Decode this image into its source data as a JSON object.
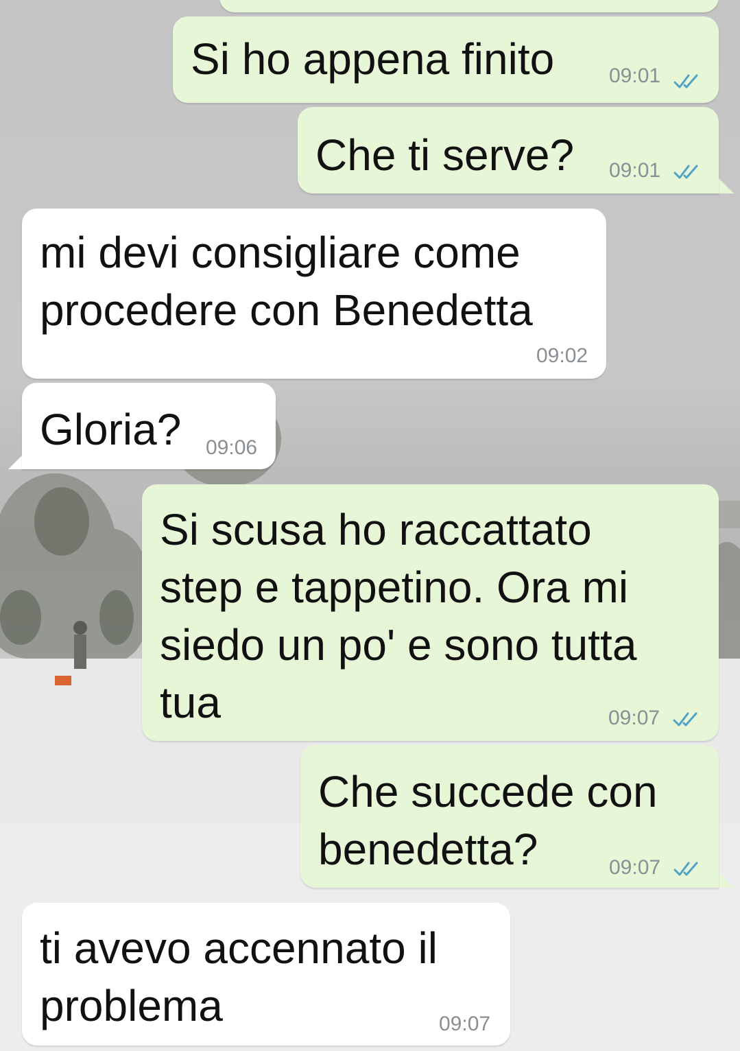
{
  "chat": {
    "accent_tick_color": "#4fa3c7",
    "messages": [
      {
        "direction": "outgoing",
        "text": "Si ho appena finito",
        "time": "09:01",
        "status_icon": "double-check-icon"
      },
      {
        "direction": "outgoing",
        "text": "Che ti serve?",
        "time": "09:01",
        "status_icon": "double-check-icon"
      },
      {
        "direction": "incoming",
        "text": "mi devi consigliare come\nprocedere con Benedetta",
        "time": "09:02"
      },
      {
        "direction": "incoming",
        "text": "Gloria?",
        "time": "09:06"
      },
      {
        "direction": "outgoing",
        "text": "Si scusa ho raccattato\nstep e tappetino. Ora mi\nsiedo un po' e sono tutta\ntua",
        "time": "09:07",
        "status_icon": "double-check-icon"
      },
      {
        "direction": "outgoing",
        "text": "Che succede con\nbenedetta?",
        "time": "09:07",
        "status_icon": "double-check-icon"
      },
      {
        "direction": "incoming",
        "text": "ti avevo accennato il\nproblema",
        "time": "09:07"
      }
    ]
  }
}
